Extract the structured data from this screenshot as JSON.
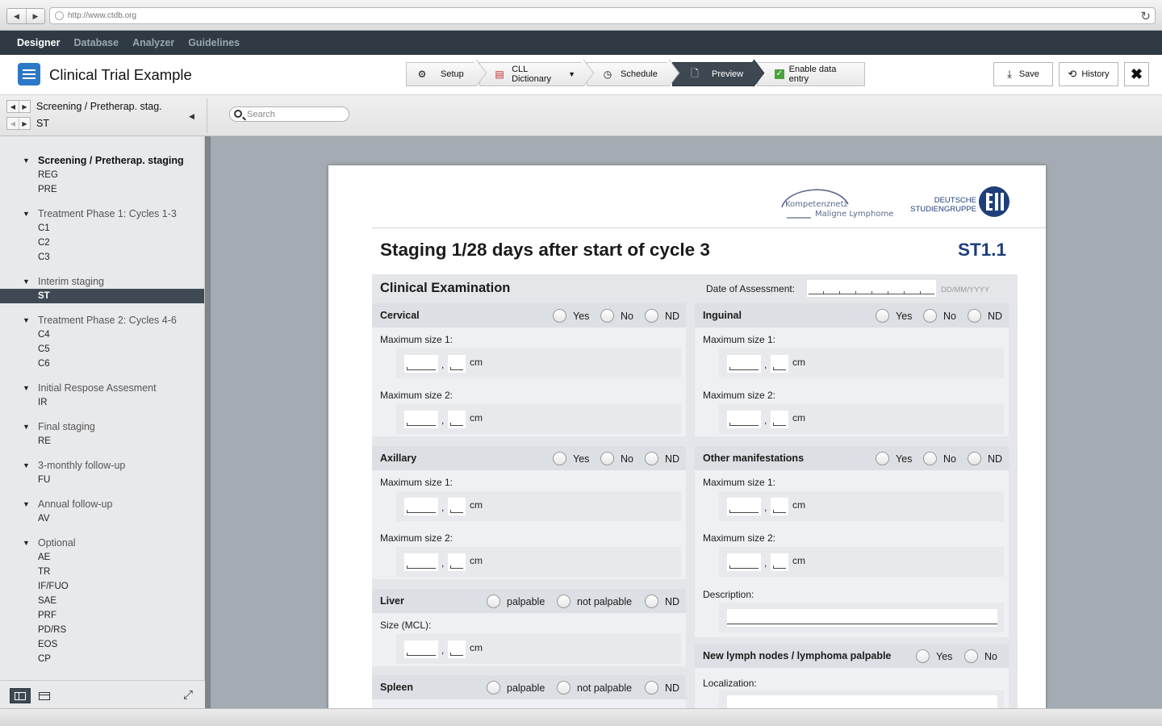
{
  "browser": {
    "url": "http://www.ctdb.org"
  },
  "topnav": {
    "items": [
      "Designer",
      "Database",
      "Analyzer",
      "Guidelines"
    ]
  },
  "header": {
    "title": "Clinical Trial Example",
    "steps": {
      "setup": "Setup",
      "dictionary": "CLL Dictionary",
      "schedule": "Schedule",
      "preview": "Preview",
      "enable": "Enable data entry"
    },
    "save": "Save",
    "history": "History"
  },
  "subheader": {
    "crumb1": "Screening / Pretherap. stag.",
    "crumb2": "ST",
    "search_placeholder": "Search"
  },
  "sidebar": {
    "groups": [
      {
        "title": "Screening / Pretherap. staging",
        "items": [
          "REG",
          "PRE"
        ]
      },
      {
        "title": "Treatment Phase 1: Cycles 1-3",
        "items": [
          "C1",
          "C2",
          "C3"
        ]
      },
      {
        "title": "Interim staging",
        "items": [
          "ST"
        ]
      },
      {
        "title": "Treatment Phase 2: Cycles 4-6",
        "items": [
          "C4",
          "C5",
          "C6"
        ]
      },
      {
        "title": "Initial Respose Assesment",
        "items": [
          "IR"
        ]
      },
      {
        "title": "Final staging",
        "items": [
          "RE"
        ]
      },
      {
        "title": "3-monthly follow-up",
        "items": [
          "FU"
        ]
      },
      {
        "title": "Annual follow-up",
        "items": [
          "AV"
        ]
      },
      {
        "title": "Optional",
        "items": [
          "AE",
          "TR",
          "IF/FUO",
          "SAE",
          "PRF",
          "PD/RS",
          "EOS",
          "CP"
        ]
      }
    ]
  },
  "form": {
    "logo_kn": "Kompetenznetz",
    "logo_ml": "Maligne Lymphome",
    "logo_dsg1": "DEUTSCHE",
    "logo_dsg2": "STUDIENGRUPPE",
    "title": "Staging 1/28 days after start of cycle 3",
    "code": "ST1.1",
    "section": "Clinical Examination",
    "date_label": "Date of Assessment:",
    "date_hint": "DD/MM/YYYY",
    "opt_yes": "Yes",
    "opt_no": "No",
    "opt_nd": "ND",
    "opt_palp": "palpable",
    "opt_notpalp": "not palpable",
    "max1": "Maximum size 1:",
    "max2": "Maximum size 2:",
    "size_mcl": "Size (MCL):",
    "unit": "cm",
    "comma": ",",
    "cervical": "Cervical",
    "inguinal": "Inguinal",
    "axillary": "Axillary",
    "other": "Other manifestations",
    "liver": "Liver",
    "spleen": "Spleen",
    "description": "Description:",
    "new_nodes": "New lymph nodes / lymphoma palpable",
    "localization": "Localization:"
  }
}
